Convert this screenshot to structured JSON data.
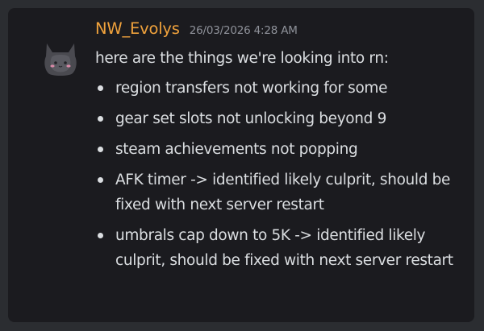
{
  "message": {
    "author": "NW_Evolys",
    "timestamp": "26/03/2026 4:28 AM",
    "intro": "here are the things we're looking into rn:",
    "items": [
      "region transfers not working for some",
      "gear set slots not unlocking beyond 9",
      "steam achievements not popping",
      "AFK timer -> identified likely culprit, should be fixed with next server restart",
      "umbrals cap down to 5K -> identified likely culprit, should be fixed with next server restart"
    ]
  },
  "colors": {
    "background": "#2b2d31",
    "card": "#1b1b1f",
    "username": "#f0a23c",
    "text": "#dbdee1",
    "timestamp": "#8f929a"
  },
  "icons": {
    "avatar": "cat-avatar-icon"
  }
}
